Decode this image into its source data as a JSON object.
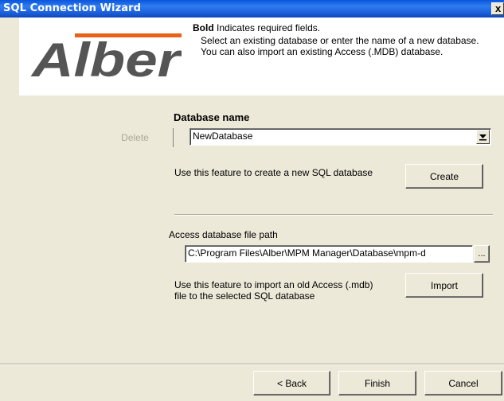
{
  "window": {
    "title": "SQL Connection Wizard",
    "close_glyph": "x"
  },
  "header": {
    "logo_text": "Alber",
    "bold_word": "Bold",
    "bold_note": "Indicates required fields.",
    "description": "Select an existing database or enter the name of a new database. You can also import an existing Access (.MDB) database."
  },
  "database": {
    "label": "Database name",
    "value": "NewDatabase",
    "delete_label": "Delete",
    "create_hint": "Use this feature to create a new SQL database",
    "create_label": "Create"
  },
  "access": {
    "label": "Access database file path",
    "path_value": "C:\\Program Files\\Alber\\MPM Manager\\Database\\mpm-d",
    "browse_label": "...",
    "import_hint_line1": "Use this feature to import an old Access (.mdb)",
    "import_hint_line2": "file to the selected SQL database",
    "import_label": "Import"
  },
  "footer": {
    "back_label": "< Back",
    "finish_label": "Finish",
    "cancel_label": "Cancel"
  },
  "colors": {
    "title_bar": "#1b5ed8",
    "logo": "#555555",
    "face": "#ece9d8"
  }
}
